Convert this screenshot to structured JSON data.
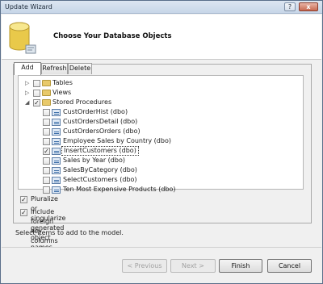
{
  "window": {
    "title": "Update Wizard"
  },
  "header": {
    "title": "Choose Your Database Objects"
  },
  "tabs": [
    "Add",
    "Refresh",
    "Delete"
  ],
  "tree": {
    "tables": "Tables",
    "views": "Views",
    "stored_procedures": "Stored Procedures",
    "procedures": [
      {
        "label": "CustOrderHist (dbo)",
        "checked": false
      },
      {
        "label": "CustOrdersDetail (dbo)",
        "checked": false
      },
      {
        "label": "CustOrdersOrders (dbo)",
        "checked": false
      },
      {
        "label": "Employee Sales by Country (dbo)",
        "checked": false
      },
      {
        "label": "InsertCustomers (dbo)",
        "checked": true
      },
      {
        "label": "Sales by Year (dbo)",
        "checked": false
      },
      {
        "label": "SalesByCategory (dbo)",
        "checked": false
      },
      {
        "label": "SelectCustomers (dbo)",
        "checked": false
      },
      {
        "label": "Ten Most Expensive Products (dbo)",
        "checked": false
      }
    ]
  },
  "options": {
    "pluralize": "Pluralize or singularize generated object names",
    "foreign_keys": "Include foreign key columns in the model"
  },
  "hint": "Select items to add to the model.",
  "buttons": {
    "previous": "< Previous",
    "next": "Next >",
    "finish": "Finish",
    "cancel": "Cancel"
  },
  "titlebar_buttons": {
    "help": "?",
    "close": "x"
  }
}
